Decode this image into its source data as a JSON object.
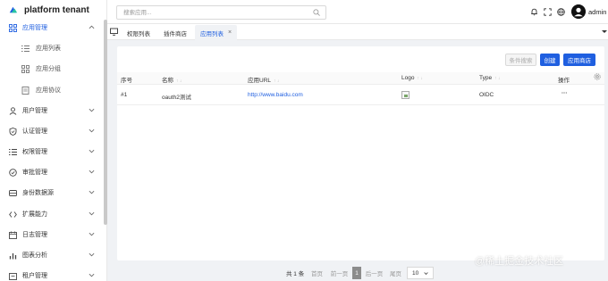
{
  "brand": {
    "name": "platform tenant"
  },
  "sidebar": {
    "groups": [
      {
        "label": "应用管理",
        "icon": "grid-icon",
        "expanded": true,
        "active": true
      },
      {
        "label": "用户管理",
        "icon": "user-icon"
      },
      {
        "label": "认证管理",
        "icon": "shield-icon"
      },
      {
        "label": "权限管理",
        "icon": "list-icon"
      },
      {
        "label": "审批管理",
        "icon": "check-circle-icon"
      },
      {
        "label": "身份数据源",
        "icon": "database-icon"
      },
      {
        "label": "扩展能力",
        "icon": "code-icon"
      },
      {
        "label": "日志管理",
        "icon": "calendar-icon"
      },
      {
        "label": "图表分析",
        "icon": "bar-chart-icon"
      },
      {
        "label": "租户管理",
        "icon": "tenant-icon"
      }
    ],
    "sub_items": [
      {
        "label": "应用列表",
        "icon": "list-icon"
      },
      {
        "label": "应用分组",
        "icon": "grid-icon"
      },
      {
        "label": "应用协议",
        "icon": "document-icon"
      }
    ]
  },
  "header": {
    "search_placeholder": "搜索应用...",
    "username": "admin"
  },
  "tabs": {
    "items": [
      {
        "label": "权限列表"
      },
      {
        "label": "插件商店"
      },
      {
        "label": "应用列表",
        "active": true,
        "close": "×"
      }
    ]
  },
  "toolbar": {
    "filter_label": "条件搜索",
    "create_label": "创建",
    "store_label": "应用商店"
  },
  "table": {
    "columns": [
      "序号",
      "名称",
      "应用URL",
      "Logo",
      "Type",
      "操作"
    ],
    "sort_glyph": "↑ ↓",
    "rows": [
      {
        "index": "#1",
        "name": "oauth2测试",
        "url": "http://www.baidu.com",
        "type": "OIDC",
        "action": "···"
      }
    ]
  },
  "pagination": {
    "total": "共 1 条",
    "first": "首页",
    "prev": "前一页",
    "current": "1",
    "next": "后一页",
    "last": "尾页",
    "page_size": "10"
  },
  "watermark": "@稀土掘金技术社区",
  "colors": {
    "accent": "#1f5fe0",
    "brand_green": "#26c6a2"
  }
}
